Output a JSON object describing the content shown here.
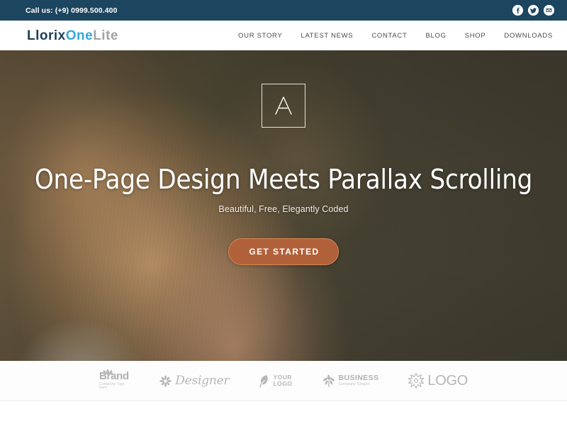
{
  "topbar": {
    "phone": "Call us: (+9) 0999.500.400",
    "social": [
      {
        "name": "facebook-icon",
        "glyph": "f",
        "label": "Facebook"
      },
      {
        "name": "twitter-icon",
        "glyph": "t",
        "label": "Twitter"
      },
      {
        "name": "email-icon",
        "glyph": "e",
        "label": "Email"
      }
    ],
    "background_color": "#1c455f"
  },
  "header": {
    "logo": {
      "part1": "Llorix",
      "part2": "One",
      "part3": "Lite",
      "color1": "#1c3f57",
      "color2": "#36a8d8",
      "color3": "#a3a3a3"
    },
    "nav": [
      {
        "label": "OUR STORY"
      },
      {
        "label": "LATEST NEWS"
      },
      {
        "label": "CONTACT"
      },
      {
        "label": "BLOG"
      },
      {
        "label": "SHOP"
      },
      {
        "label": "DOWNLOADS"
      }
    ]
  },
  "hero": {
    "mark": "lambda-logo-icon",
    "title": "One-Page Design Meets Parallax Scrolling",
    "subtitle": "Beautiful, Free, Elegantly Coded",
    "cta_label": "GET STARTED",
    "cta_color": "#b1613a",
    "cta_border_color": "#d68a52"
  },
  "clients": [
    {
      "icon": "crown-icon",
      "name": "Brand",
      "slogan": "Company logo here"
    },
    {
      "icon": "flower-star-icon",
      "name": "Designer",
      "slogan": ""
    },
    {
      "icon": "leaf-icon",
      "name": "YOUR",
      "slogan": "LOGO"
    },
    {
      "icon": "maple-leaf-icon",
      "name": "BUSINESS",
      "slogan": "Company Slogan"
    },
    {
      "icon": "starburst-icon",
      "name": "LOGO",
      "slogan": ""
    }
  ]
}
